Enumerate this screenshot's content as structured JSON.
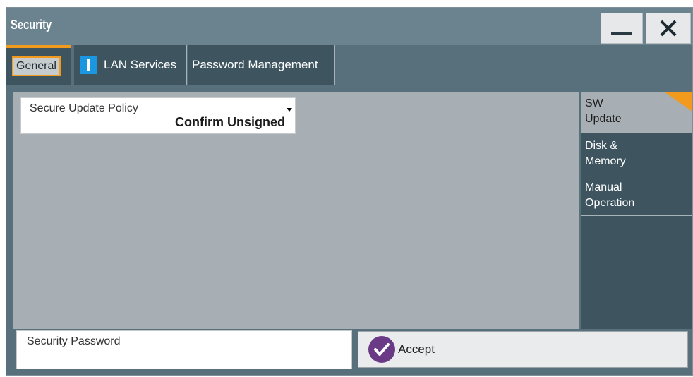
{
  "window": {
    "title": "Security",
    "minimize_icon": "minimize-icon",
    "close_icon": "close-icon"
  },
  "tabs": [
    {
      "label": "General",
      "active": true
    },
    {
      "label": "LAN Services",
      "icon": "info-icon"
    },
    {
      "label": "Password Management"
    }
  ],
  "content": {
    "secure_update_policy": {
      "label": "Secure Update Policy",
      "value": "Confirm Unsigned"
    }
  },
  "side_menu": [
    {
      "line1": "SW",
      "line2": "Update",
      "active": true
    },
    {
      "line1": "Disk &",
      "line2": "Memory"
    },
    {
      "line1": "Manual",
      "line2": "Operation"
    }
  ],
  "footer": {
    "password_label": "Security Password",
    "accept_label": "Accept",
    "accept_icon": "check-icon"
  },
  "colors": {
    "accent": "#f29a1e",
    "tab_bg": "#3e5560",
    "window_bg": "#57707c",
    "content_bg": "#a8afb4",
    "accept_icon_bg": "#6a3a86",
    "info_icon_bg": "#1a97e0"
  }
}
